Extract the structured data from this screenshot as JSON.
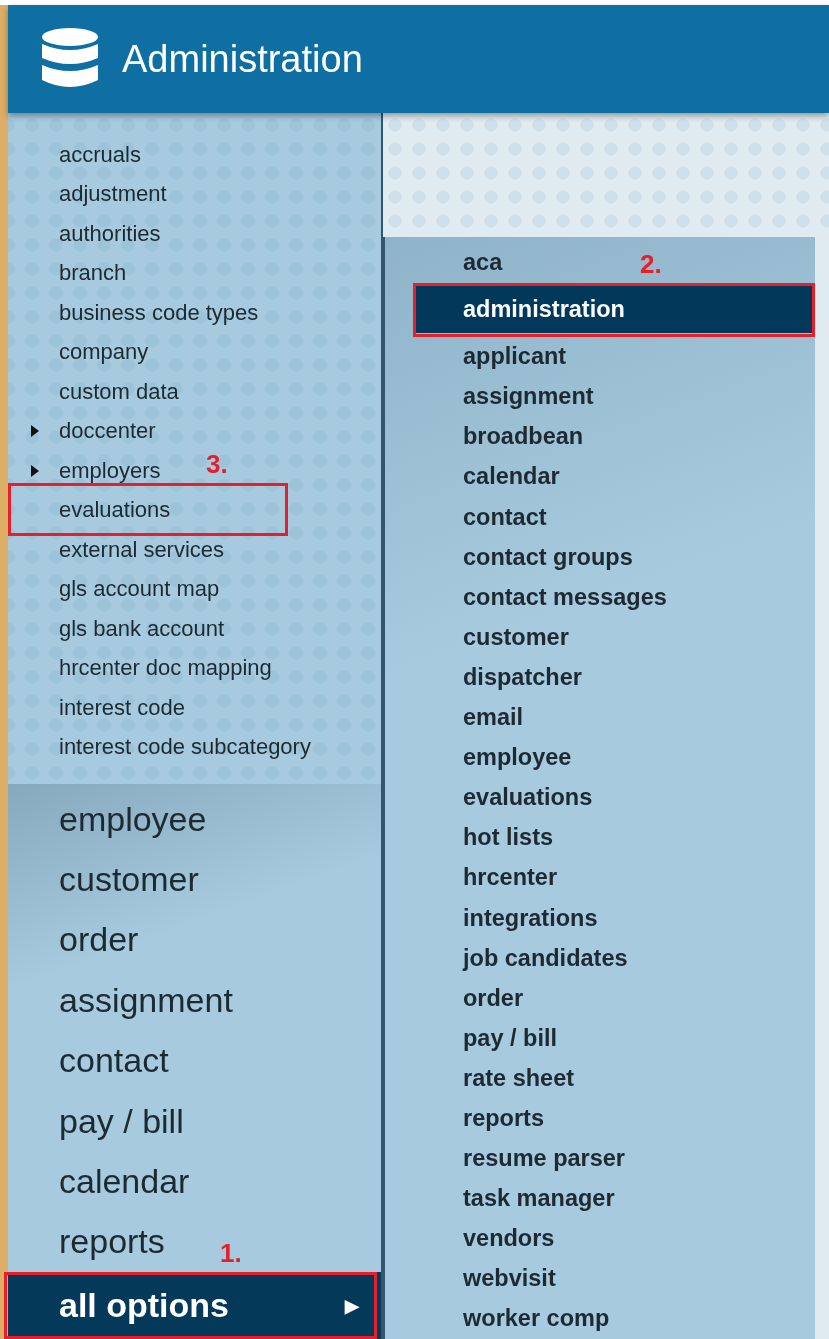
{
  "header": {
    "title": "Administration"
  },
  "admin_list": [
    {
      "label": "accruals",
      "has_submenu": false
    },
    {
      "label": "adjustment",
      "has_submenu": false
    },
    {
      "label": "authorities",
      "has_submenu": false
    },
    {
      "label": "branch",
      "has_submenu": false
    },
    {
      "label": "business code types",
      "has_submenu": false
    },
    {
      "label": "company",
      "has_submenu": false
    },
    {
      "label": "custom data",
      "has_submenu": false
    },
    {
      "label": "doccenter",
      "has_submenu": true
    },
    {
      "label": "employers",
      "has_submenu": true
    },
    {
      "label": "evaluations",
      "has_submenu": false,
      "callout": "3."
    },
    {
      "label": "external services",
      "has_submenu": false
    },
    {
      "label": "gls account map",
      "has_submenu": false
    },
    {
      "label": "gls bank account",
      "has_submenu": false
    },
    {
      "label": "hrcenter doc mapping",
      "has_submenu": false
    },
    {
      "label": "interest code",
      "has_submenu": false
    },
    {
      "label": "interest code subcategory",
      "has_submenu": false
    }
  ],
  "main_nav": [
    {
      "label": "employee"
    },
    {
      "label": "customer"
    },
    {
      "label": "order"
    },
    {
      "label": "assignment"
    },
    {
      "label": "contact"
    },
    {
      "label": "pay / bill"
    },
    {
      "label": "calendar"
    },
    {
      "label": "reports"
    }
  ],
  "all_options": {
    "label": "all options",
    "arrow": "▶",
    "selected": true,
    "callout": "1."
  },
  "submenu": [
    {
      "label": "aca",
      "selected": false
    },
    {
      "label": "administration",
      "selected": true,
      "callout": "2."
    },
    {
      "label": "applicant",
      "selected": false
    },
    {
      "label": "assignment",
      "selected": false
    },
    {
      "label": "broadbean",
      "selected": false
    },
    {
      "label": "calendar",
      "selected": false
    },
    {
      "label": "contact",
      "selected": false
    },
    {
      "label": "contact groups",
      "selected": false
    },
    {
      "label": "contact messages",
      "selected": false
    },
    {
      "label": "customer",
      "selected": false
    },
    {
      "label": "dispatcher",
      "selected": false
    },
    {
      "label": "email",
      "selected": false
    },
    {
      "label": "employee",
      "selected": false
    },
    {
      "label": "evaluations",
      "selected": false
    },
    {
      "label": "hot lists",
      "selected": false
    },
    {
      "label": "hrcenter",
      "selected": false
    },
    {
      "label": "integrations",
      "selected": false
    },
    {
      "label": "job candidates",
      "selected": false
    },
    {
      "label": "order",
      "selected": false
    },
    {
      "label": "pay / bill",
      "selected": false
    },
    {
      "label": "rate sheet",
      "selected": false
    },
    {
      "label": "reports",
      "selected": false
    },
    {
      "label": "resume parser",
      "selected": false
    },
    {
      "label": "task manager",
      "selected": false
    },
    {
      "label": "vendors",
      "selected": false
    },
    {
      "label": "webvisit",
      "selected": false
    },
    {
      "label": "worker comp",
      "selected": false
    }
  ]
}
